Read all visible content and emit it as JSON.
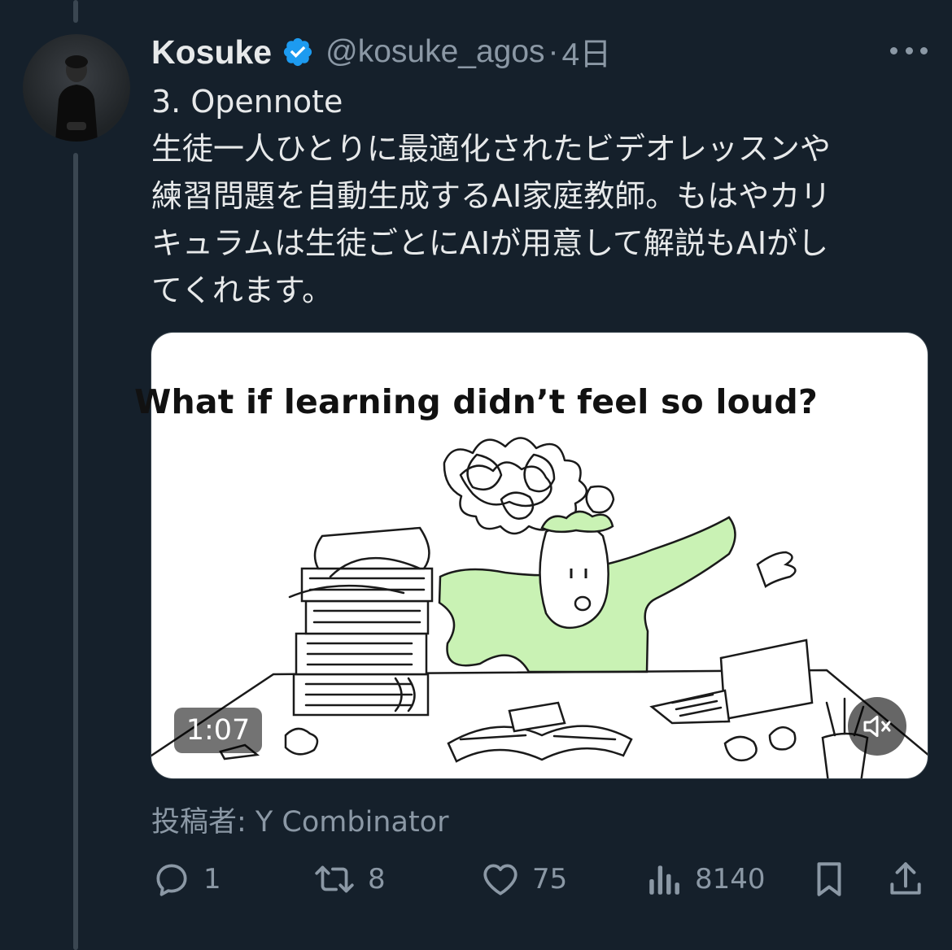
{
  "tweet": {
    "author_name": "Kosuke",
    "handle": "@kosuke_agos",
    "separator": "·",
    "time": "4日",
    "text_lines": [
      "3. Opennote",
      "生徒一人ひとりに最適化されたビデオレッスンや",
      "練習問題を自動生成するAI家庭教師。もはやカリ",
      "キュラムは生徒ごとにAIが用意して解説もAIがし",
      "てくれます。"
    ]
  },
  "media": {
    "headline": "What if learning didn’t feel so loud?",
    "duration": "1:07",
    "attribution": "投稿者: Y Combinator"
  },
  "actions": {
    "replies": "1",
    "reposts": "8",
    "likes": "75",
    "views": "8140"
  },
  "colors": {
    "background": "#15202b",
    "verified": "#1d9bf0",
    "secondary_text": "#8b98a5",
    "illustration_green": "#c9f2b4"
  },
  "icons": [
    "verified-badge-icon",
    "more-icon",
    "mute-icon",
    "reply-icon",
    "repost-icon",
    "like-icon",
    "views-icon",
    "bookmark-icon",
    "share-icon"
  ]
}
